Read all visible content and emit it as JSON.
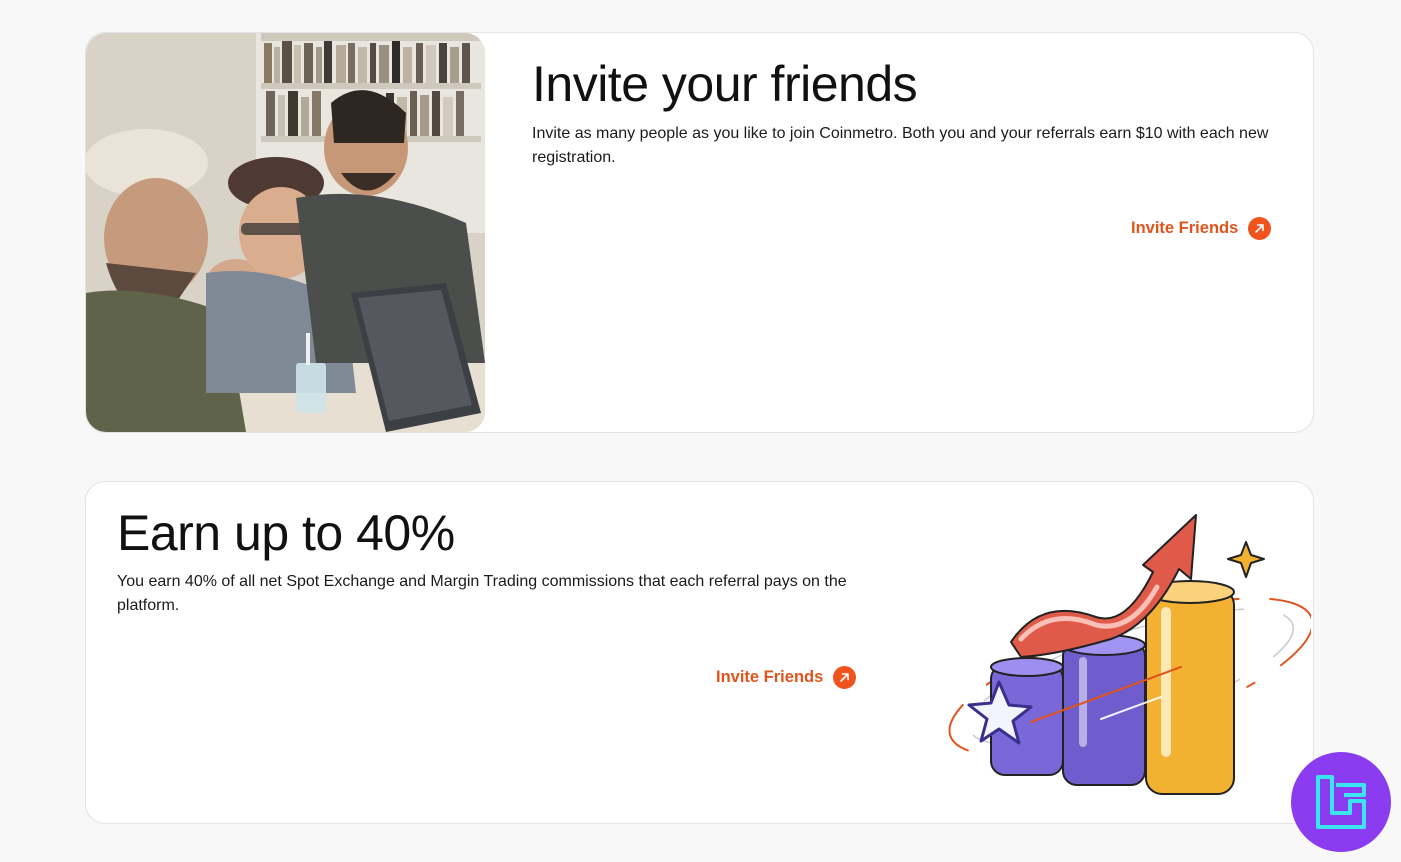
{
  "referral": {
    "title": "Invite your friends",
    "description": "Invite as many people as you like to join Coinmetro. Both you and your referrals earn $10 with each new registration.",
    "cta_label": "Invite Friends",
    "image_alt": "Friends laughing around a laptop"
  },
  "commission": {
    "title": "Earn up to 40%",
    "description": "You earn 40% of all net Spot Exchange and Margin Trading commissions that each referral pays on the platform.",
    "cta_label": "Invite Friends",
    "image_alt": "Rising bar chart with arrow illustration"
  },
  "colors": {
    "accent": "#f0541c",
    "accent_text": "#e0541c",
    "badge": "#8b3cf0",
    "bar_purple": "#7b68d8",
    "bar_gold": "#f2b130"
  },
  "icons": {
    "cta_icon": "arrow-up-right-icon",
    "badge_icon": "brand-logo-icon"
  }
}
